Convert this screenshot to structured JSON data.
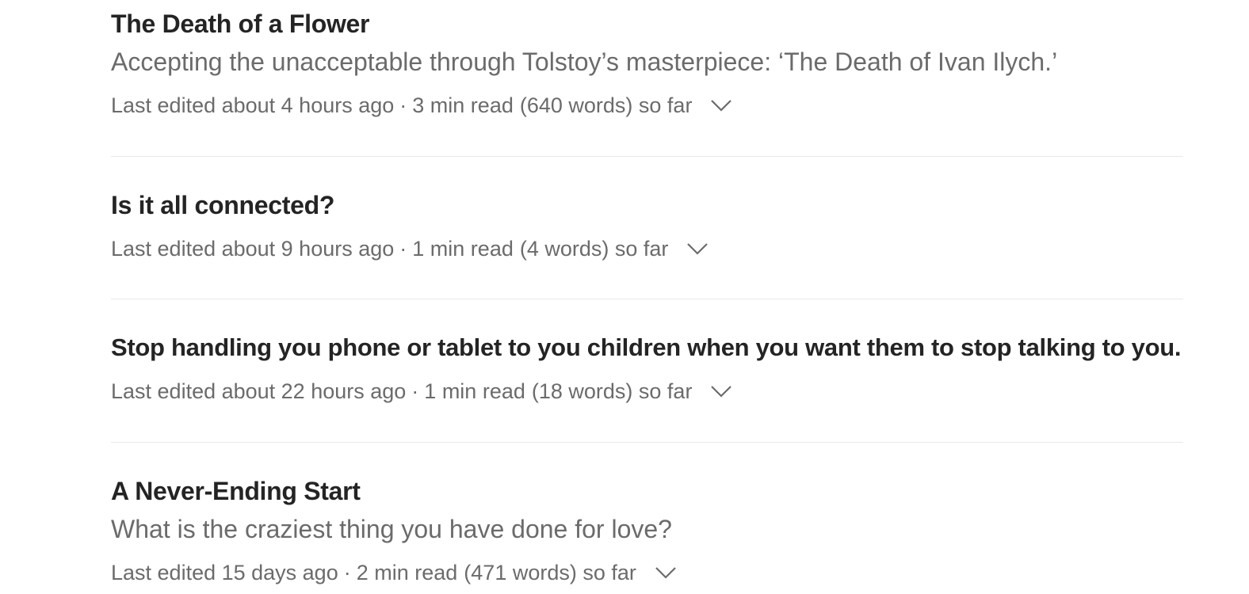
{
  "drafts": [
    {
      "title": "The Death of a Flower",
      "subtitle": "Accepting the unacceptable through Tolstoy’s masterpiece: ‘The Death of Ivan Ilych.’",
      "edited": "Last edited about 4 hours ago",
      "separator": "·",
      "read_time": "3 min read",
      "words": "(640 words) so far",
      "menu_icon": "chevron-down-icon"
    },
    {
      "title": "Is it all connected?",
      "subtitle": "",
      "edited": "Last edited about 9 hours ago",
      "separator": "·",
      "read_time": "1 min read",
      "words": "(4 words) so far",
      "menu_icon": "chevron-down-icon"
    },
    {
      "title": "Stop handling you phone or tablet to you children when you want them to stop talking to you.",
      "subtitle": "",
      "edited": "Last edited about 22 hours ago",
      "separator": "·",
      "read_time": "1 min read",
      "words": "(18 words) so far",
      "menu_icon": "chevron-down-icon"
    },
    {
      "title": "A Never-Ending Start",
      "subtitle": "What is the craziest thing you have done for love?",
      "edited": "Last edited 15 days ago",
      "separator": "·",
      "read_time": "2 min read",
      "words": "(471 words) so far",
      "menu_icon": "chevron-down-icon"
    }
  ],
  "colors": {
    "title": "#242424",
    "secondary_text": "#6b6b6b",
    "divider": "#e9e9e9",
    "background": "#ffffff"
  }
}
